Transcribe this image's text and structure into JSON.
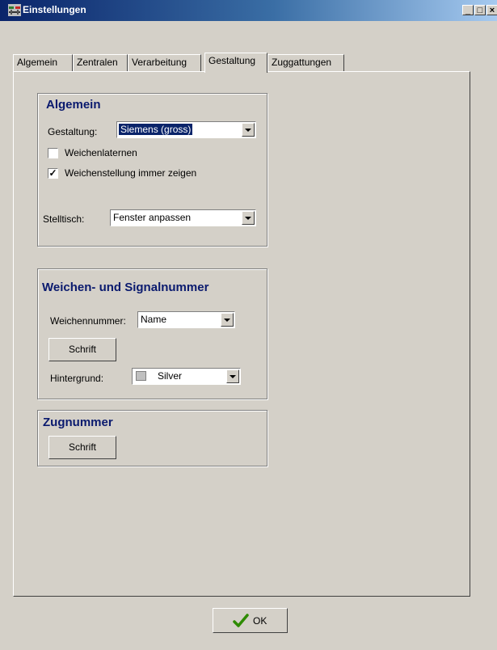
{
  "window": {
    "title": "Einstellungen",
    "minimize": "_",
    "maximize": "□",
    "close": "×"
  },
  "tabs": [
    "Algemein",
    "Zentralen",
    "Verarbeitung",
    "Gestaltung",
    "Zuggattungen"
  ],
  "active_tab": "Gestaltung",
  "groups": {
    "algemein": {
      "title": "Algemein",
      "gestaltung_label": "Gestaltung:",
      "gestaltung_value": "Siemens (gross)",
      "weichenlaternen_label": "Weichenlaternen",
      "weichenlaternen_checked": false,
      "weichenstellung_label": "Weichenstellung immer zeigen",
      "weichenstellung_checked": true,
      "check_mark": "✓",
      "stelltisch_label": "Stelltisch:",
      "stelltisch_value": "Fenster anpassen"
    },
    "weichen": {
      "title": "Weichen- und Signalnummer",
      "weichennummer_label": "Weichennummer:",
      "weichennummer_value": "Name",
      "schrift_button": "Schrift",
      "hintergrund_label": "Hintergrund:",
      "hintergrund_value": "Silver",
      "hintergrund_color": "#c0c0c0"
    },
    "zugnummer": {
      "title": "Zugnummer",
      "schrift_button": "Schrift"
    }
  },
  "ok_button": {
    "label": "OK",
    "icon": "check-icon",
    "icon_color": "#2e8b00"
  }
}
